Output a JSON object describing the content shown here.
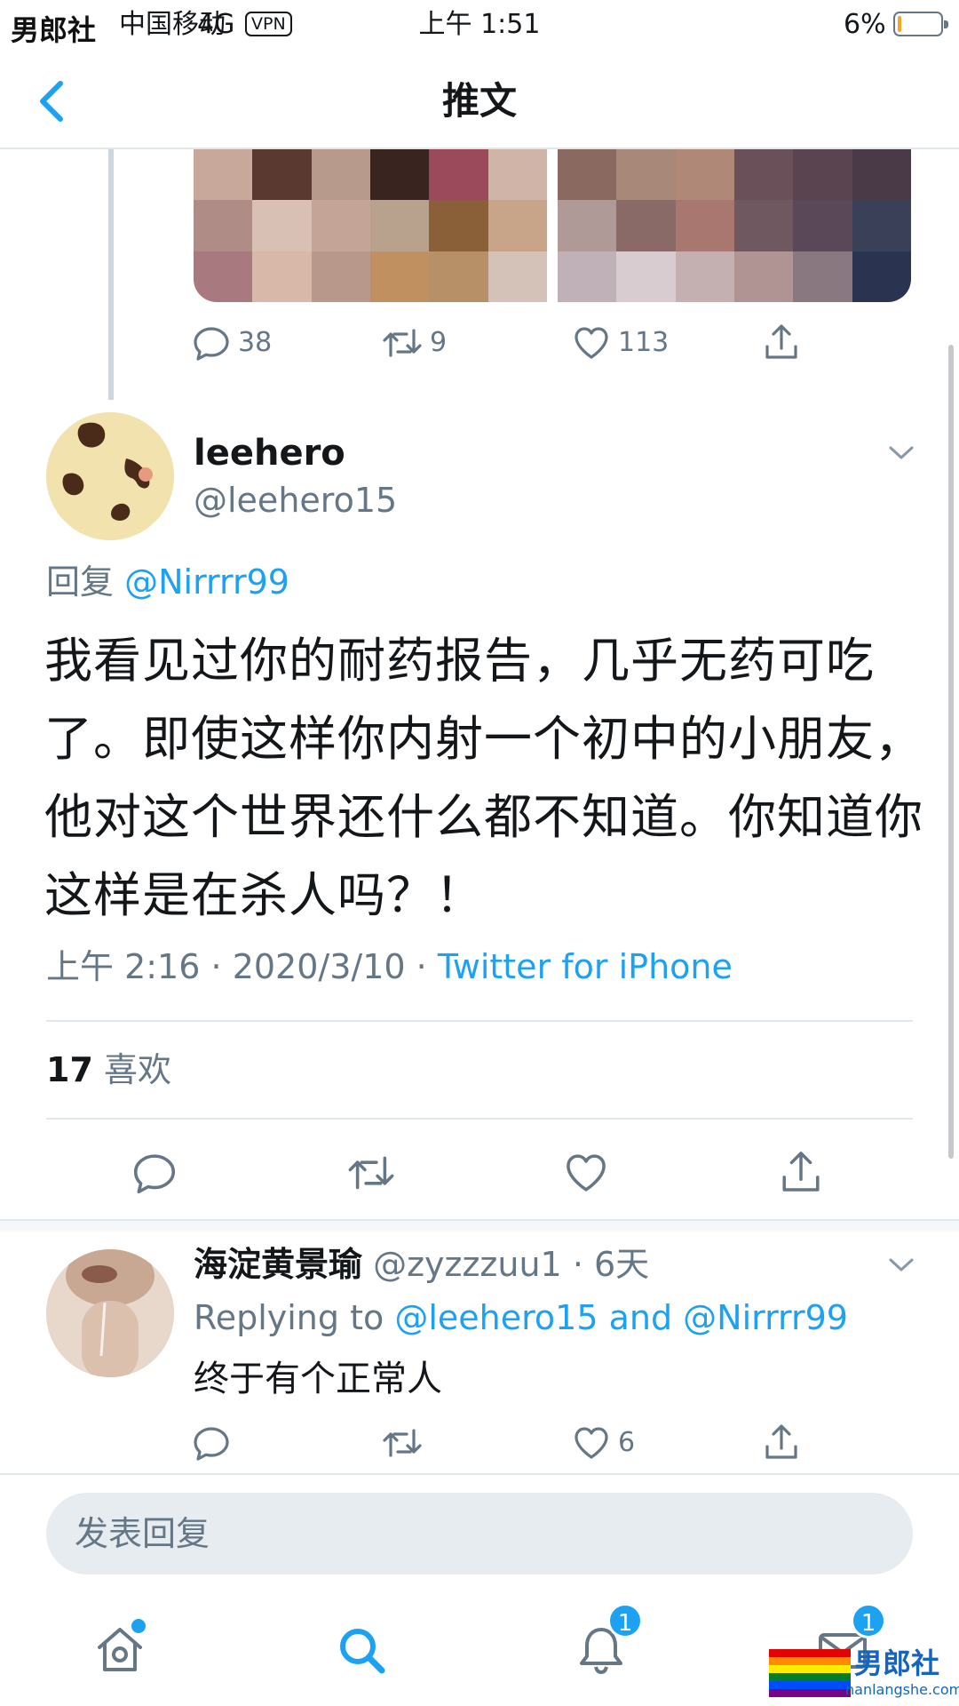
{
  "watermark_top_left": "男郎社",
  "watermark_bottom_right": {
    "title": "男郎社",
    "url": "nanlangshe.com"
  },
  "status_bar": {
    "carrier": "中国移动",
    "network": "4G",
    "vpn": "VPN",
    "time": "上午 1:51",
    "battery": "6%"
  },
  "nav": {
    "title": "推文",
    "back_icon": "chevron-left-icon"
  },
  "parent_tweet": {
    "media_pixel_colors_1": [
      "#c9a89c",
      "#5a3a30",
      "#b89a8c",
      "#3a2420",
      "#9a4a5a",
      "#d0b4a8",
      "#b08c86",
      "#d8c0b4",
      "#c4a496",
      "#b8a28e",
      "#8a6038",
      "#c8a488",
      "#a87a80",
      "#d8b8a8",
      "#b8988a",
      "#c09060",
      "#b89068",
      "#d4c2b8"
    ],
    "media_pixel_colors_2": [
      "#8a6a60",
      "#a88878",
      "#b08878",
      "#6a5058",
      "#5a4450",
      "#4a3a48",
      "#b09a98",
      "#8a6a66",
      "#a87870",
      "#705860",
      "#5a4858",
      "#3a4058",
      "#c0b0b8",
      "#d8ccd0",
      "#c4b0b0",
      "#b09494",
      "#8a7880",
      "#2a3450"
    ],
    "actions": {
      "comments": "38",
      "retweets": "9",
      "likes": "113"
    }
  },
  "main_tweet": {
    "author_name": "leehero",
    "author_handle": "@leehero15",
    "reply_prefix": "回复",
    "reply_to": "@Nirrrr99",
    "text": "我看见过你的耐药报告，几乎无药可吃了。即使这样你内射一个初中的小朋友，他对这个世界还什么都不知道。你知道你这样是在杀人吗？！",
    "time": "上午 2:16",
    "date": "2020/3/10",
    "separator": "·",
    "source": "Twitter for iPhone",
    "likes_count": "17",
    "likes_label": "喜欢"
  },
  "reply_tweet": {
    "author_name": "海淀黄景瑜",
    "author_handle": "@zyzzzuu1",
    "age": "· 6天",
    "replying_prefix": "Replying to",
    "replying_users": "@leehero15 and @Nirrrr99",
    "text": "终于有个正常人",
    "likes": "6"
  },
  "compose": {
    "placeholder": "发表回复"
  },
  "tab_bar": {
    "tabs": [
      "home-icon",
      "search-icon",
      "notifications-icon",
      "messages-icon"
    ],
    "notifications_badge": "1",
    "messages_badge": "1"
  },
  "colors": {
    "accent": "#1da1f2",
    "text": "#14171a",
    "muted": "#657786",
    "divider": "#e1e8ed"
  }
}
